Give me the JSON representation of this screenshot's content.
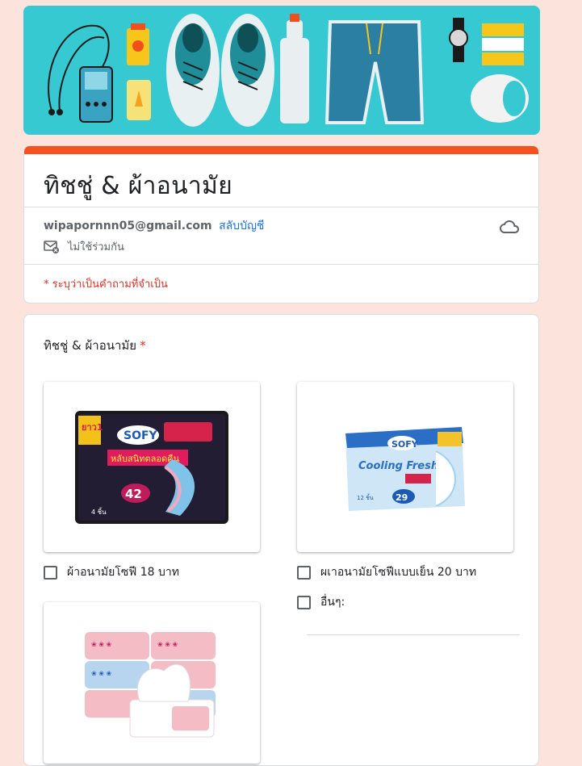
{
  "form": {
    "title": "ทิชชู่ & ผ้าอนามัย",
    "account_email": "wipapornnn05@gmail.com",
    "switch_account": "สลับบัญชี",
    "not_shared": "ไม่ใช้ร่วมกัน",
    "required_note": "* ระบุว่าเป็นคำถามที่จำเป็น"
  },
  "question": {
    "title": "ทิชชู่ & ผ้าอนามัย",
    "required_mark": "*",
    "options": [
      {
        "label": "ผ้าอนามัยโซฟี 18 บาท",
        "checked": false
      },
      {
        "label": "ผเาอนามัยโซฟีแบบเย็น 20 บาท",
        "checked": false
      },
      {
        "label": "อื่นๆ:",
        "checked": false
      }
    ],
    "images": [
      {
        "brand": "SOFY",
        "text": "หลับสนิทตลอดคืน",
        "number": "42",
        "count": "4 ชิ้น",
        "badge": "ยาว1"
      },
      {
        "brand": "SOFY",
        "text": "Cooling Fresh",
        "number": "29",
        "count": "12 ชิ้น"
      },
      {
        "brand": "tissue"
      }
    ]
  },
  "colors": {
    "accent": "#f4511e",
    "page_bg": "#fce4dc",
    "banner_bg": "#36c9d2",
    "required": "#d93025",
    "link": "#1a73e8"
  },
  "icons": {
    "cloud": "cloud-done-icon",
    "not_shared": "mail-off-icon"
  }
}
